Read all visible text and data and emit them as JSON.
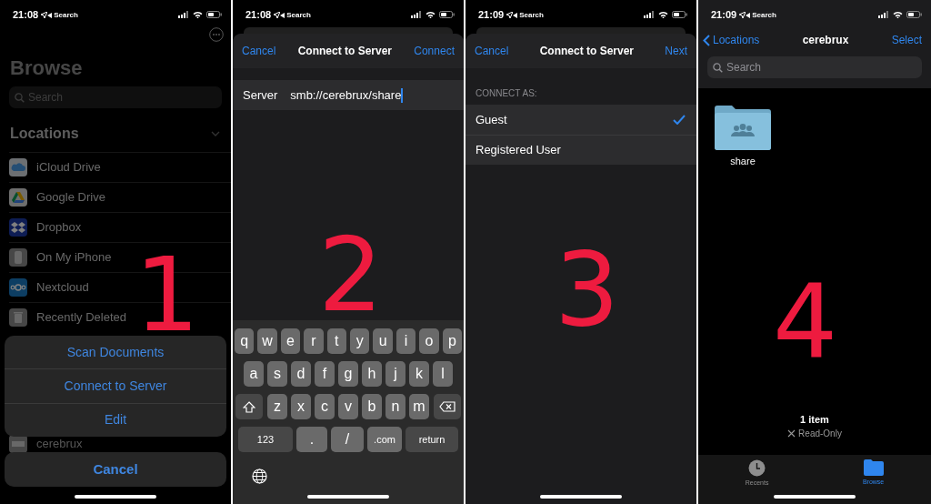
{
  "panels": [
    {
      "kind": "browse",
      "status": {
        "time": "21:08",
        "back": "Search"
      },
      "title": "Browse",
      "search": {
        "placeholder": "Search"
      },
      "section": "Locations",
      "locations": [
        {
          "name": "iCloud Drive",
          "kind": "icloud"
        },
        {
          "name": "Google Drive",
          "kind": "gdrive"
        },
        {
          "name": "Dropbox",
          "kind": "dropbox"
        },
        {
          "name": "On My iPhone",
          "kind": "device"
        },
        {
          "name": "Nextcloud",
          "kind": "nextcloud"
        },
        {
          "name": "Recently Deleted",
          "kind": "trash"
        }
      ],
      "partly_hidden_item": {
        "name": "cerebrux",
        "kind": "server"
      },
      "action_sheet": {
        "actions": [
          "Scan Documents",
          "Connect to Server",
          "Edit"
        ],
        "cancel": "Cancel"
      },
      "step": "1"
    },
    {
      "kind": "server_form",
      "status": {
        "time": "21:08",
        "back": "Search"
      },
      "nav": {
        "cancel": "Cancel",
        "title": "Connect to Server",
        "action": "Connect"
      },
      "field": {
        "label": "Server",
        "value": "smb://cerebrux/share",
        "focused": true
      },
      "keyboard": {
        "rows": [
          [
            "q",
            "w",
            "e",
            "r",
            "t",
            "y",
            "u",
            "i",
            "o",
            "p"
          ],
          [
            "a",
            "s",
            "d",
            "f",
            "g",
            "h",
            "j",
            "k",
            "l"
          ],
          [
            "z",
            "x",
            "c",
            "v",
            "b",
            "n",
            "m"
          ]
        ],
        "bottom": [
          {
            "label": "123",
            "kind": "function"
          },
          {
            "label": ".",
            "kind": "char"
          },
          {
            "label": "/",
            "kind": "char"
          },
          {
            "label": ".com",
            "kind": "char"
          },
          {
            "label": "return",
            "kind": "function"
          }
        ]
      },
      "step": "2"
    },
    {
      "kind": "connect_as",
      "status": {
        "time": "21:09",
        "back": "Search"
      },
      "nav": {
        "cancel": "Cancel",
        "title": "Connect to Server",
        "action": "Next"
      },
      "section": "CONNECT AS:",
      "options": [
        {
          "label": "Guest",
          "selected": true
        },
        {
          "label": "Registered User",
          "selected": false
        }
      ],
      "step": "3"
    },
    {
      "kind": "folder",
      "status": {
        "time": "21:09",
        "back": "Search"
      },
      "nav": {
        "back": "Locations",
        "title": "cerebrux",
        "action": "Select"
      },
      "search": {
        "placeholder": "Search"
      },
      "items": [
        {
          "name": "share"
        }
      ],
      "footer": {
        "count": "1 item",
        "access": "Read-Only"
      },
      "tabs": [
        {
          "label": "Recents",
          "selected": false
        },
        {
          "label": "Browse",
          "selected": true
        }
      ],
      "step": "4"
    }
  ]
}
